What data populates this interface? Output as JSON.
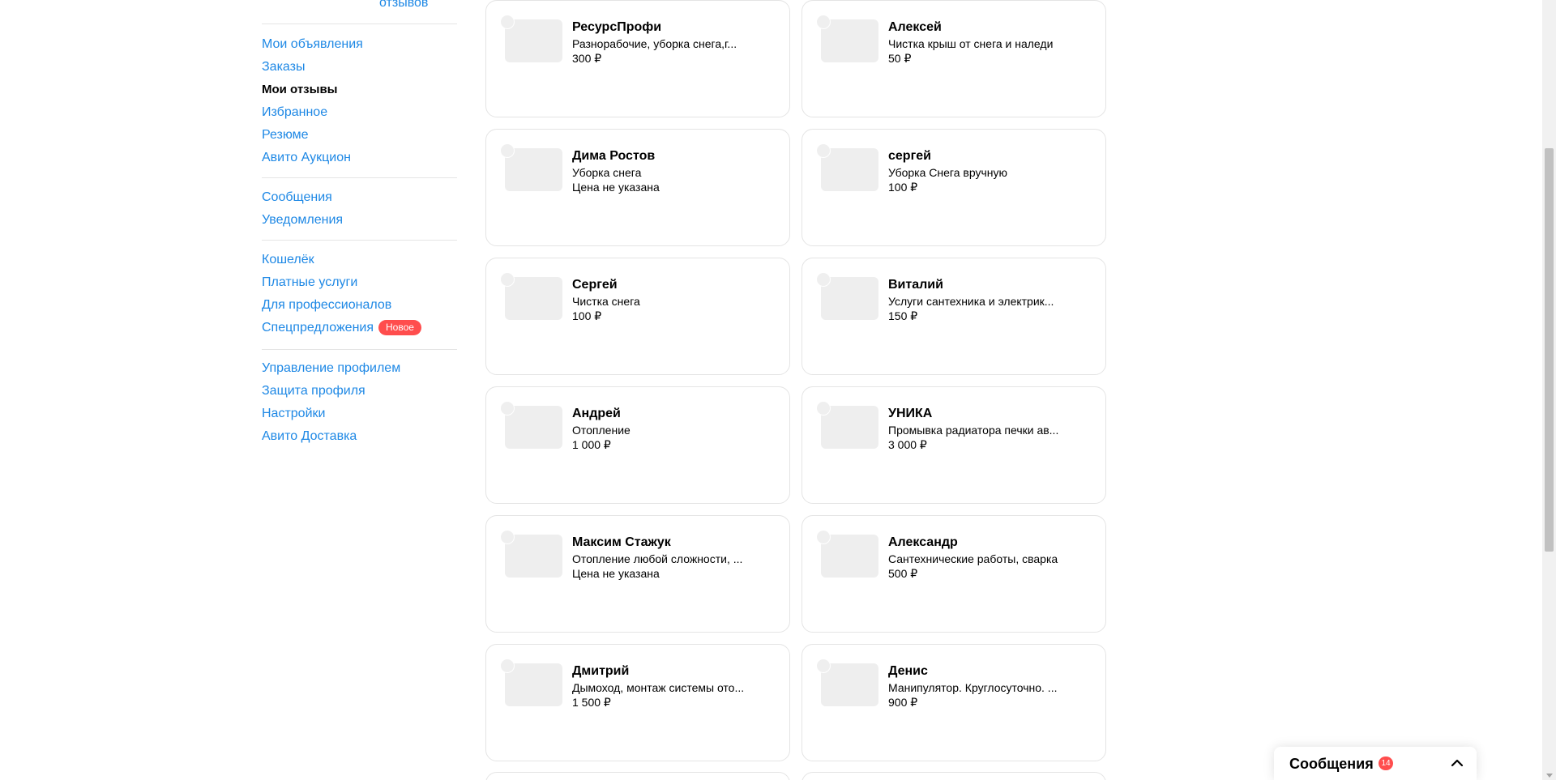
{
  "sidebar": {
    "top_link": "отзывов",
    "groups": [
      {
        "items": [
          {
            "label": "Мои объявления",
            "active": false
          },
          {
            "label": "Заказы",
            "active": false
          },
          {
            "label": "Мои отзывы",
            "active": true
          },
          {
            "label": "Избранное",
            "active": false
          },
          {
            "label": "Резюме",
            "active": false
          },
          {
            "label": "Авито Аукцион",
            "active": false
          }
        ]
      },
      {
        "items": [
          {
            "label": "Сообщения",
            "active": false
          },
          {
            "label": "Уведомления",
            "active": false
          }
        ]
      },
      {
        "items": [
          {
            "label": "Кошелёк",
            "active": false
          },
          {
            "label": "Платные услуги",
            "active": false
          },
          {
            "label": "Для профессионалов",
            "active": false
          },
          {
            "label": "Спецпредложения",
            "active": false,
            "badge": "Новое"
          }
        ]
      },
      {
        "items": [
          {
            "label": "Управление профилем",
            "active": false
          },
          {
            "label": "Защита профиля",
            "active": false
          },
          {
            "label": "Настройки",
            "active": false
          },
          {
            "label": "Авито Доставка",
            "active": false
          }
        ]
      }
    ]
  },
  "cards": [
    {
      "name": "РесурсПрофи",
      "desc": "Разнорабочие, уборка снега,г...",
      "price": "300 ₽"
    },
    {
      "name": "Алексей",
      "desc": "Чистка крыш от снега и наледи",
      "price": "50 ₽"
    },
    {
      "name": "Дима Ростов",
      "desc": "Уборка снега",
      "price": "Цена не указана"
    },
    {
      "name": "сергей",
      "desc": "Уборка Снега вручную",
      "price": "100 ₽"
    },
    {
      "name": "Сергей",
      "desc": "Чистка снега",
      "price": "100 ₽"
    },
    {
      "name": "Виталий",
      "desc": "Услуги сантехника и электрик...",
      "price": "150 ₽"
    },
    {
      "name": "Андрей",
      "desc": "Отопление",
      "price": "1 000 ₽"
    },
    {
      "name": "УНИКА",
      "desc": "Промывка радиатора печки ав...",
      "price": "3 000 ₽"
    },
    {
      "name": "Максим Стажук",
      "desc": "Отопление любой сложности, ...",
      "price": "Цена не указана"
    },
    {
      "name": "Александр",
      "desc": "Сантехнические работы, сварка",
      "price": "500 ₽"
    },
    {
      "name": "Дмитрий",
      "desc": "Дымоход, монтаж системы ото...",
      "price": "1 500 ₽"
    },
    {
      "name": "Денис",
      "desc": "Манипулятор. Круглосуточно. ...",
      "price": "900 ₽"
    }
  ],
  "messages_widget": {
    "title": "Сообщения",
    "count": "14"
  },
  "colors": {
    "link": "#1e88e5",
    "badge": "#ff4d4d"
  },
  "icons": {
    "collapse": "chevron-up-icon"
  }
}
